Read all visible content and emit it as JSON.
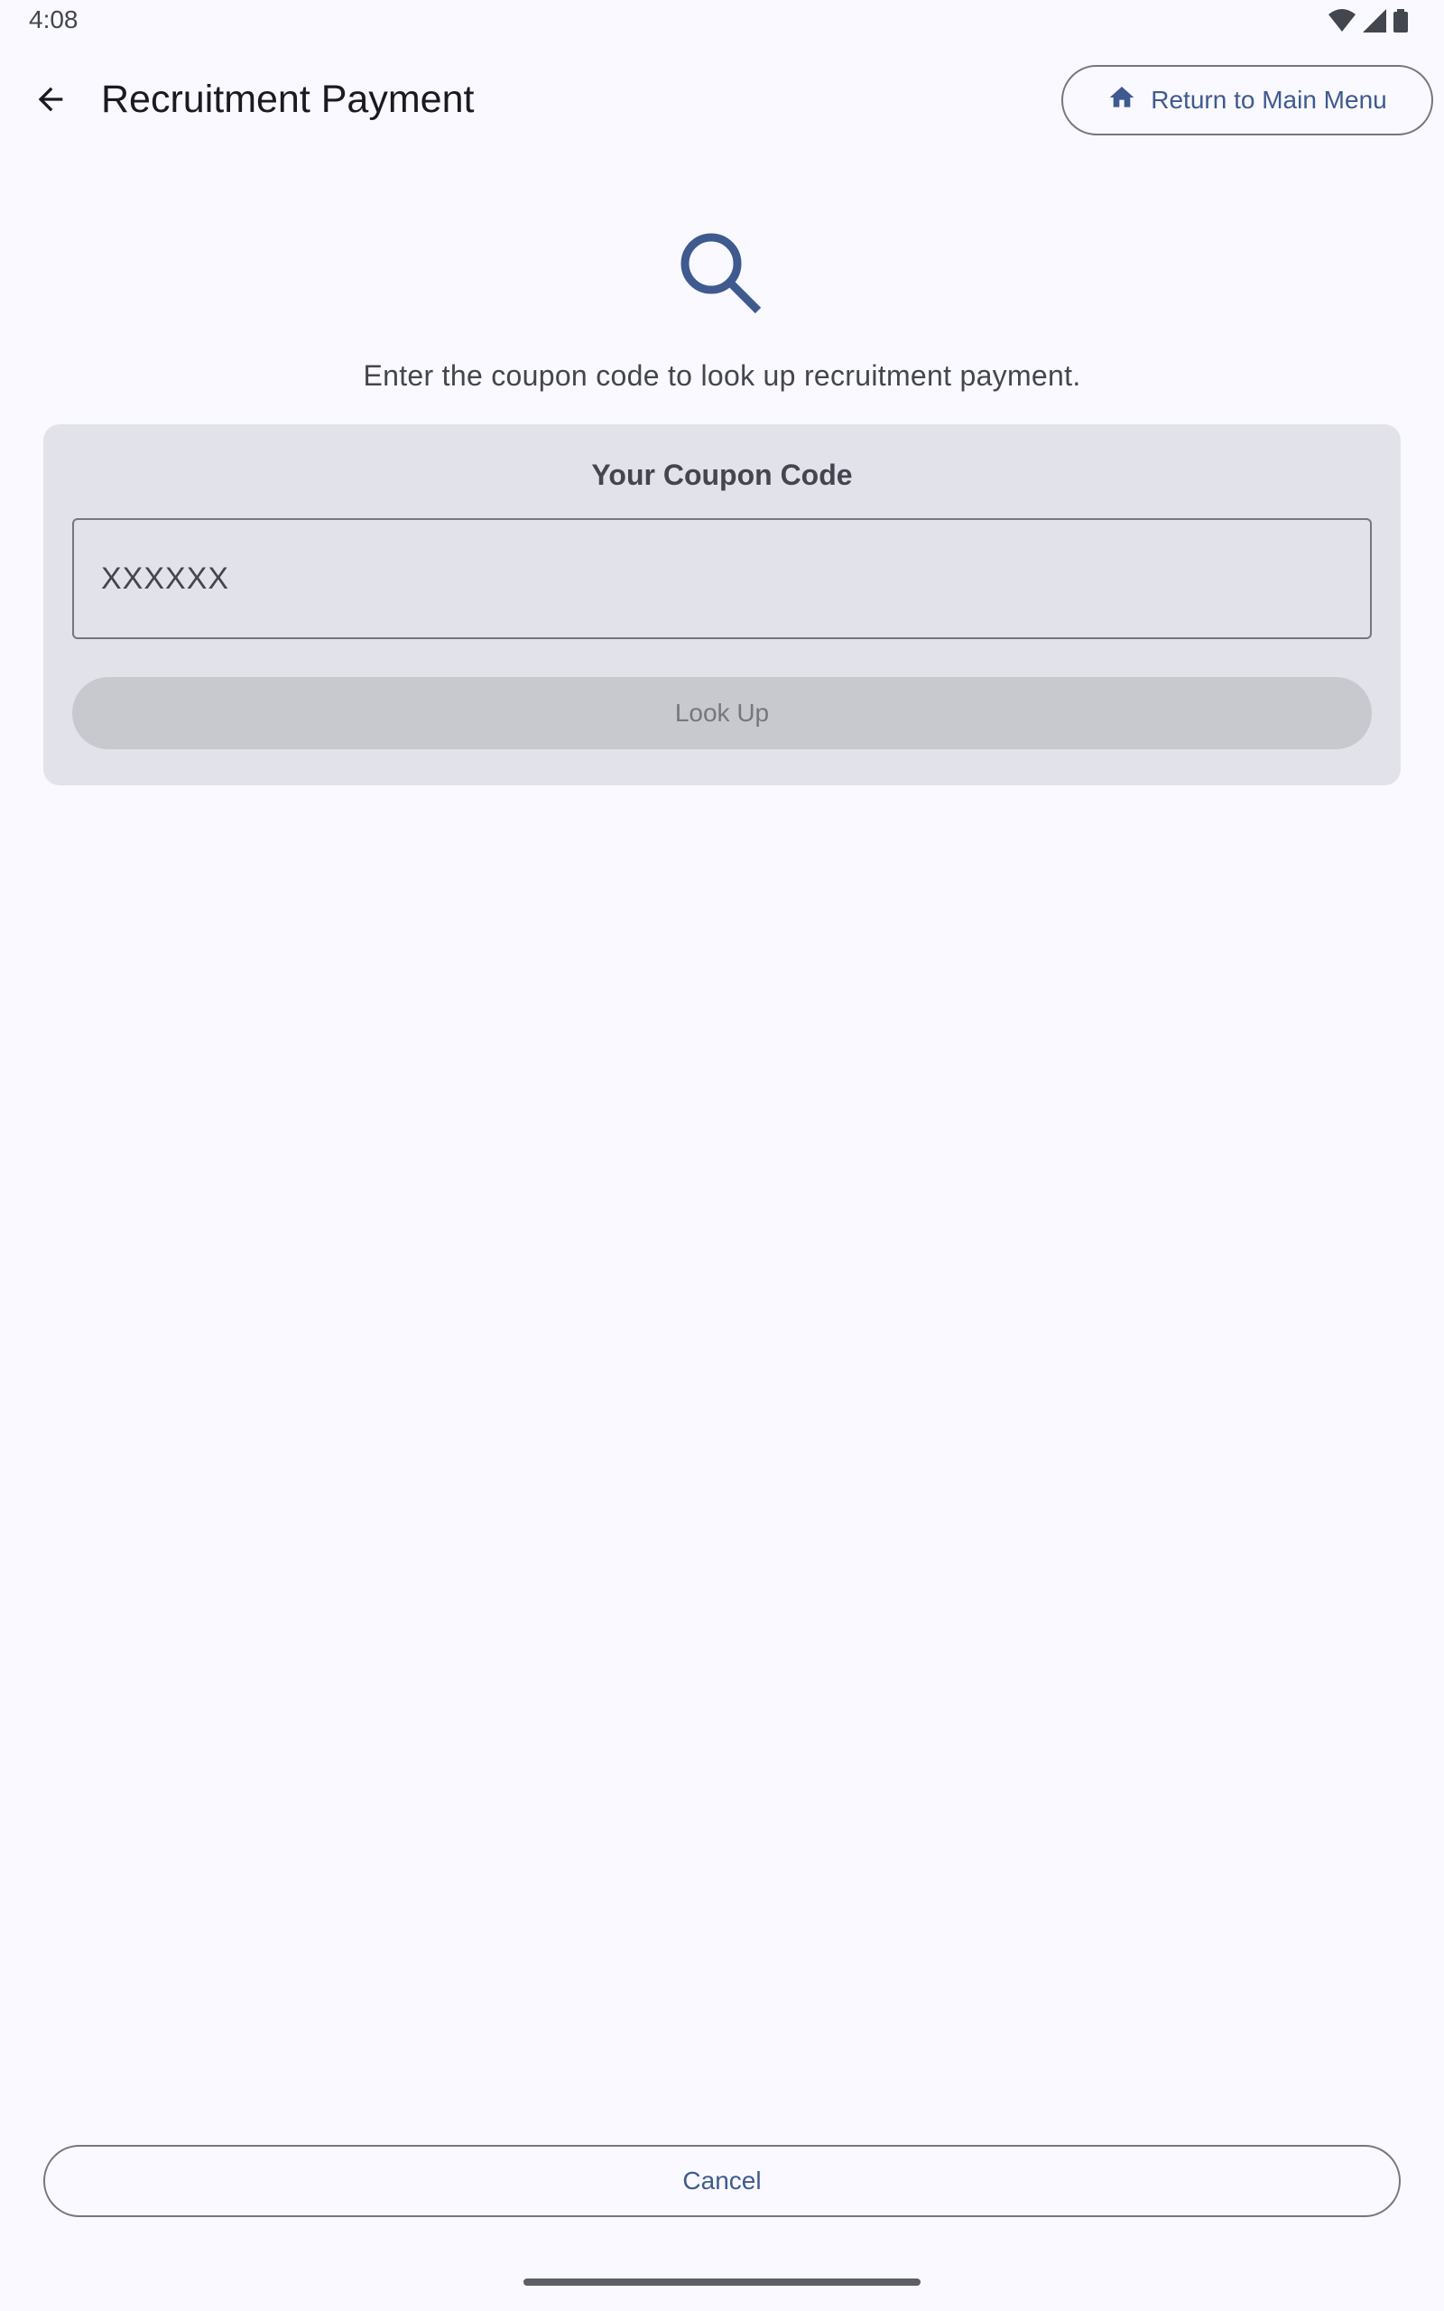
{
  "status_bar": {
    "time": "4:08",
    "icons": [
      "wifi-icon",
      "signal-icon",
      "battery-icon"
    ]
  },
  "header": {
    "back_icon": "arrow-back-icon",
    "title": "Recruitment Payment",
    "main_menu_button": {
      "icon": "home-icon",
      "label": "Return to Main Menu"
    }
  },
  "main": {
    "hero_icon": "search-icon",
    "instruction": "Enter the coupon code to look up recruitment payment.",
    "card": {
      "title": "Your Coupon Code",
      "input": {
        "value": "",
        "placeholder": "XXXXXX"
      },
      "lookup_button": {
        "label": "Look Up",
        "enabled": false
      }
    }
  },
  "footer": {
    "cancel_label": "Cancel"
  },
  "colors": {
    "background": "#f9f9ff",
    "primary": "#3f5a8f",
    "card": "#e2e2ea",
    "outline": "#74777f",
    "disabled_button": "#c8c8cf"
  }
}
